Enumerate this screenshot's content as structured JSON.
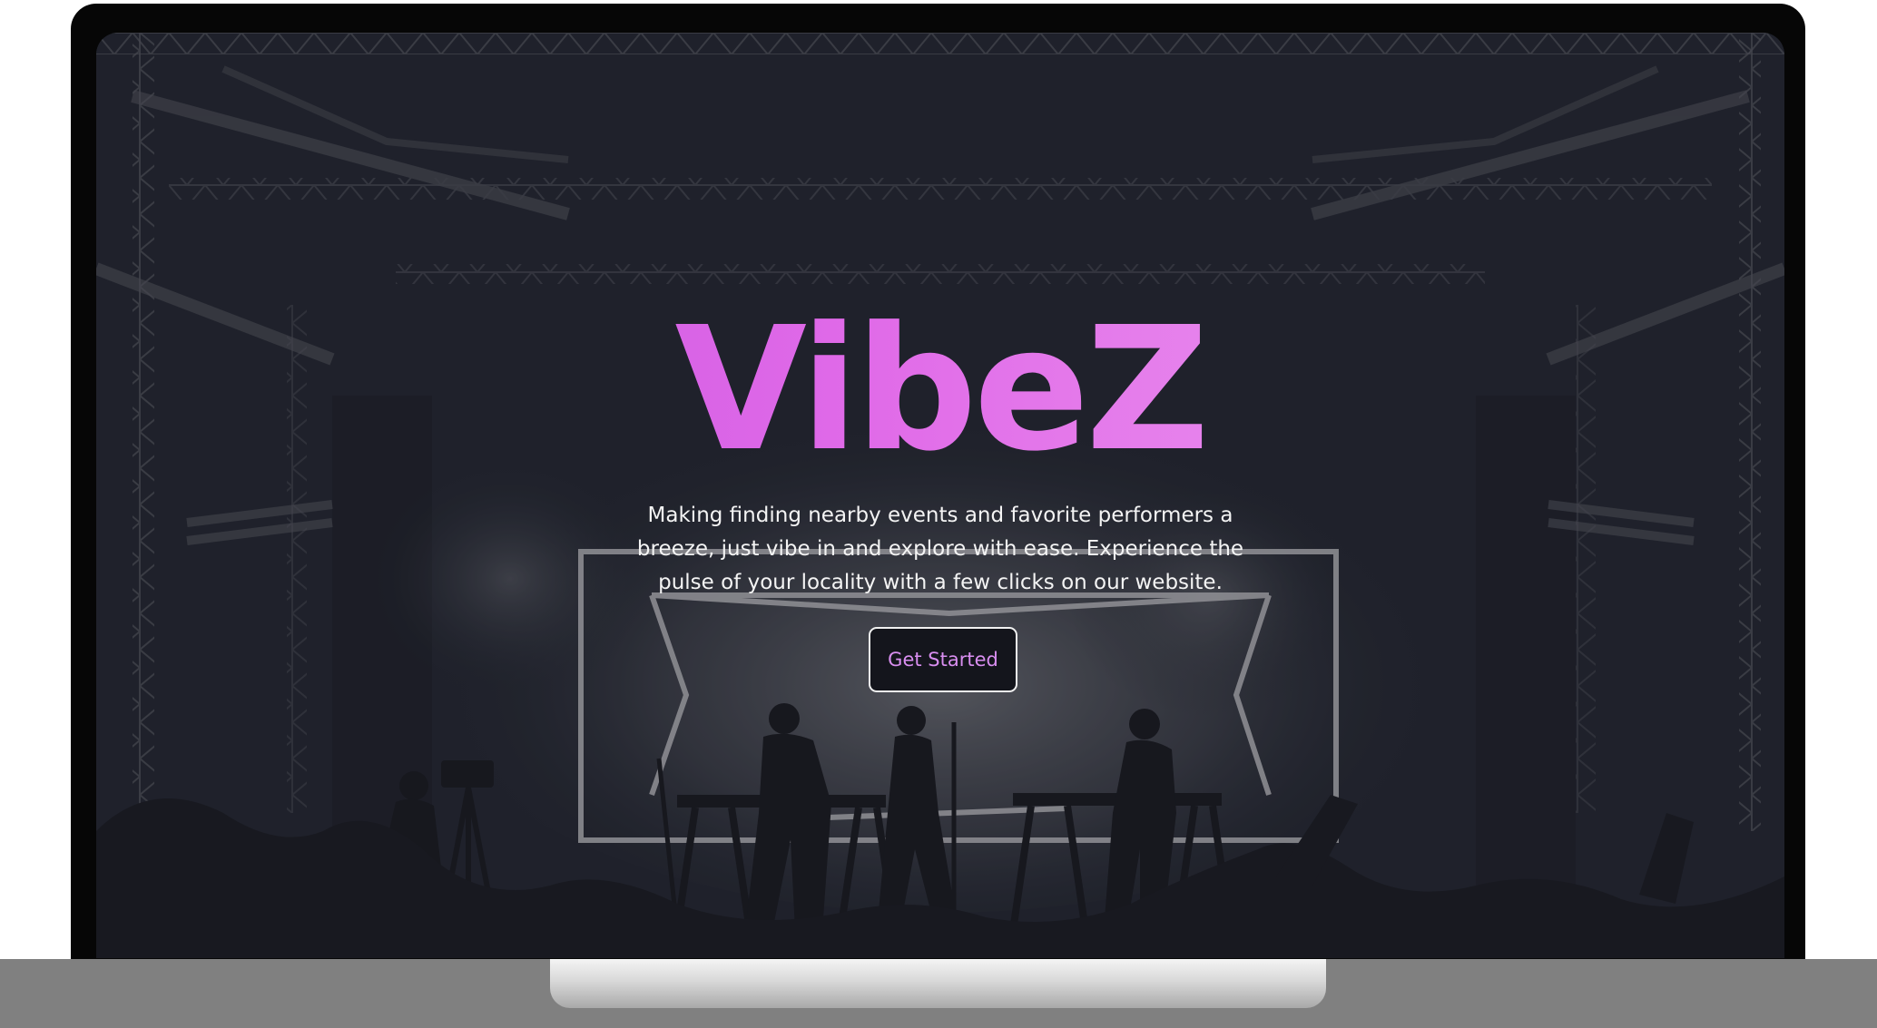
{
  "hero": {
    "title": "VibeZ",
    "description": "Making finding nearby events and favorite performers a breeze, just vibe in and explore with ease. Experience the pulse of your locality with a few clicks on our website.",
    "cta_label": "Get Started"
  },
  "colors": {
    "screen_background": "#1f222b",
    "title_gradient_start": "#c04ee0",
    "title_gradient_end": "#f0a9f2",
    "button_text": "#d98ef0",
    "button_background": "#14151c",
    "laptop_bezel": "#060606",
    "laptop_base": "#808080"
  },
  "background_image": "concert-stage-silhouette"
}
